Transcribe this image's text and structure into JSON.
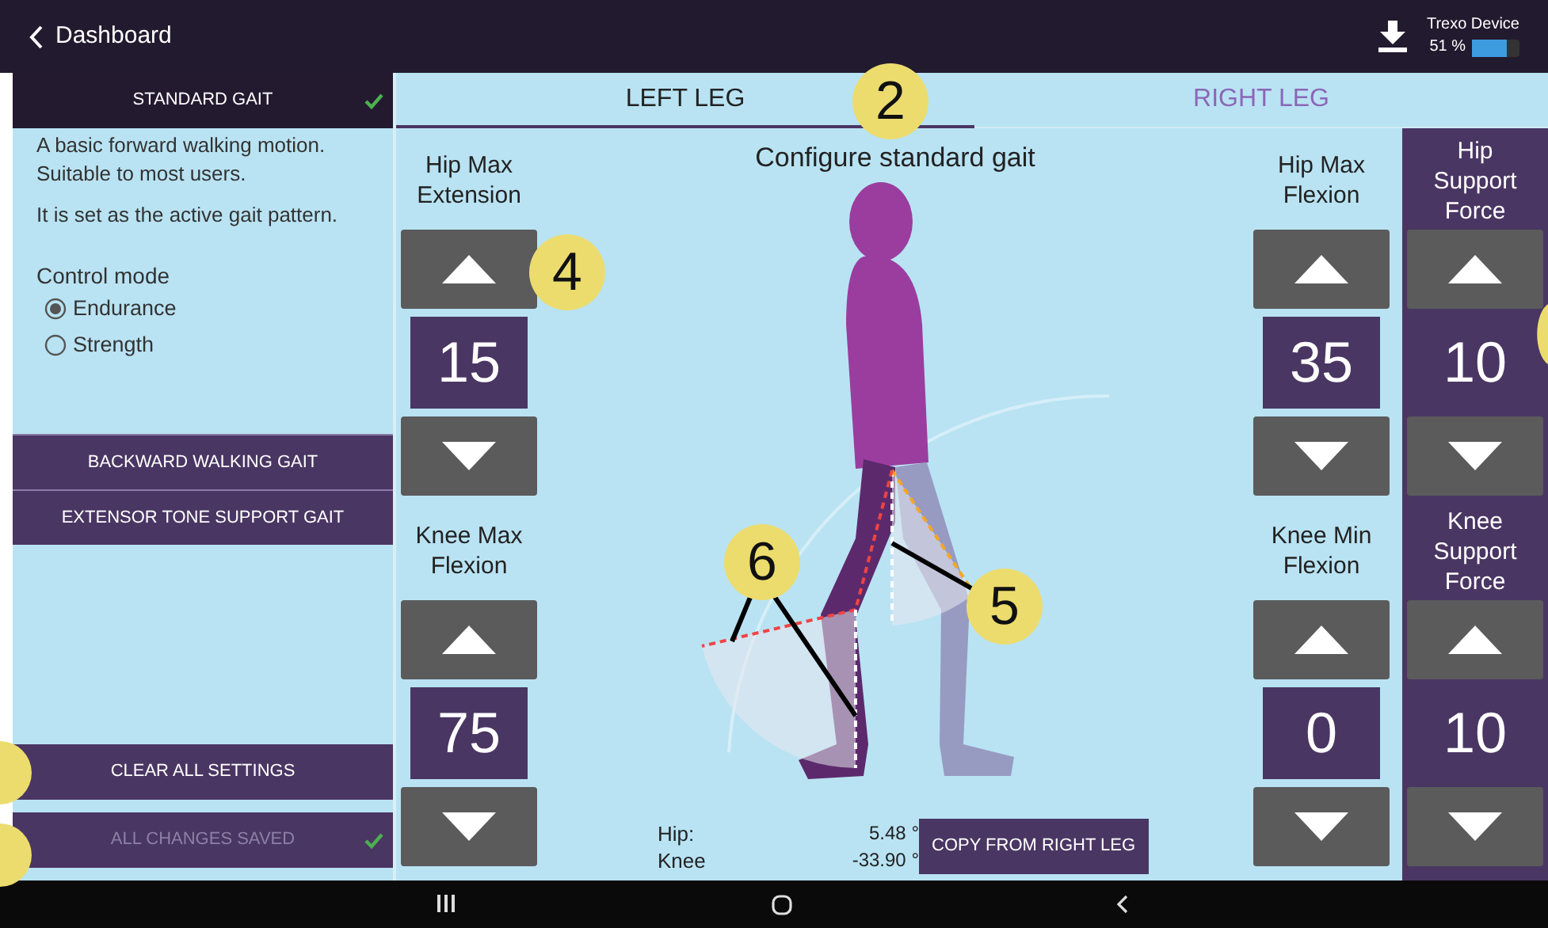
{
  "top_bar": {
    "back_label": "Dashboard",
    "device_name": "Trexo Device",
    "battery_text": "51 %"
  },
  "gaits": [
    {
      "label": "STANDARD GAIT",
      "selected": true,
      "checked": true
    },
    {
      "label": "BACKWARD WALKING GAIT",
      "selected": false,
      "checked": false
    },
    {
      "label": "EXTENSOR TONE SUPPORT GAIT",
      "selected": false,
      "checked": false
    }
  ],
  "description": [
    "A basic forward walking motion. Suitable to most users.",
    "It is set as the active gait pattern."
  ],
  "control_mode": {
    "label": "Control mode",
    "options": [
      {
        "label": "Endurance",
        "selected": true
      },
      {
        "label": "Strength",
        "selected": false
      }
    ]
  },
  "actions": [
    {
      "label": "CLEAR ALL SETTINGS",
      "disabled": false,
      "checked": false
    },
    {
      "label": "ALL CHANGES SAVED",
      "disabled": true,
      "checked": true
    }
  ],
  "tabs": [
    {
      "label": "LEFT LEG",
      "selected": true
    },
    {
      "label": "RIGHT LEG",
      "selected": false
    }
  ],
  "title": "Configure standard gait",
  "left_steppers": [
    {
      "label": "Hip Max Extension",
      "value": "15"
    },
    {
      "label": "Knee Max Flexion",
      "value": "75"
    }
  ],
  "right_steppers": [
    {
      "label": "Hip Max Flexion",
      "value": "35"
    },
    {
      "label": "Knee Min Flexion",
      "value": "0"
    }
  ],
  "force_steppers": [
    {
      "label": "Hip Support Force",
      "value": "10"
    },
    {
      "label": "Knee Support Force",
      "value": "10"
    }
  ],
  "readouts": [
    {
      "label": "Hip:",
      "value": "5.48 °"
    },
    {
      "label": "Knee",
      "value": "-33.90 °"
    }
  ],
  "copy_button": "COPY FROM RIGHT LEG",
  "callouts": [
    {
      "label": "2"
    },
    {
      "label": "4"
    },
    {
      "label": "5"
    },
    {
      "label": "6"
    }
  ]
}
